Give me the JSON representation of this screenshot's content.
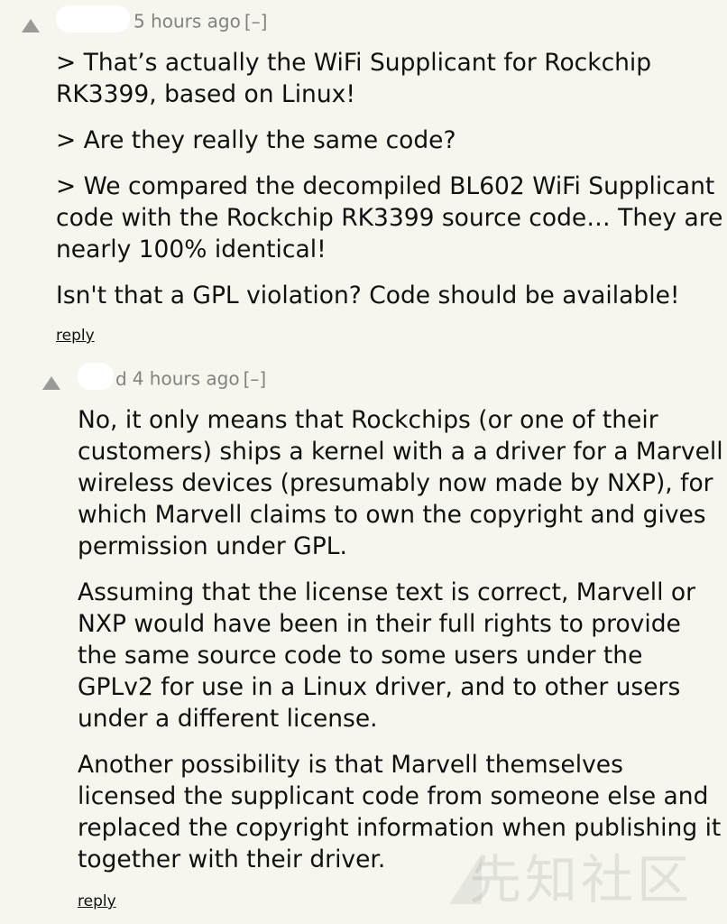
{
  "comments": [
    {
      "age": "5 hours ago",
      "toggle": "[–]",
      "paragraphs": [
        "> That’s actually the WiFi Supplicant for Rockchip RK3399, based on Linux!",
        "> Are they really the same code?",
        "> We compared the decompiled BL602 WiFi Supplicant code with the Rockchip RK3399 source code… They are nearly 100% identical!",
        "Isn't that a GPL violation? Code should be available!"
      ],
      "reply": "reply"
    },
    {
      "username_fragment": "d",
      "age": "4 hours ago",
      "toggle": "[–]",
      "paragraphs": [
        "No, it only means that Rockchips (or one of their customers) ships a kernel with a a driver for a Marvell wireless devices (presumably now made by NXP), for which Marvell claims to own the copyright and gives permission under GPL.",
        "Assuming that the license text is correct, Marvell or NXP would have been in their full rights to provide the same source code to some users under the GPLv2 for use in a Linux driver, and to other users under a different license.",
        "Another possibility is that Marvell themselves licensed the supplicant code from someone else and replaced the copyright information when publishing it together with their driver."
      ],
      "reply": "reply"
    }
  ],
  "watermark": "先知社区",
  "colors": {
    "background": "#f6f6ef",
    "meta": "#828282",
    "vote_arrow": "#9a9a9a"
  }
}
